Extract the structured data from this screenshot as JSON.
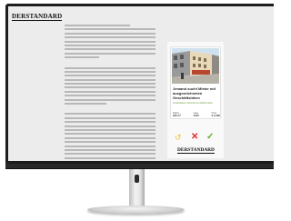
{
  "site": {
    "logo_text": "DERSTANDARD"
  },
  "ad": {
    "title": "Jemand sucht Mieter mit ausgezeichneten Geschäftsideen",
    "subtitle": "Lindenbauer-Schmid Immobilien Wien",
    "stats": [
      {
        "label": "Fläche",
        "value": "180 m²"
      },
      {
        "label": "Lage",
        "value": "1140"
      },
      {
        "label": "Preis",
        "value": "€ 2.390"
      }
    ],
    "brand_text": "DERSTANDARD"
  },
  "actions": {
    "undo_icon": "undo-icon",
    "reject_icon": "cross-icon",
    "accept_icon": "check-icon",
    "reject_color": "#e0302a",
    "accept_color": "#5fb030",
    "undo_color": "#e8c23b"
  },
  "colors": {
    "screen_bg": "#ececec",
    "text_line": "#b8b8b8",
    "bezel": "#1c1c1c"
  }
}
